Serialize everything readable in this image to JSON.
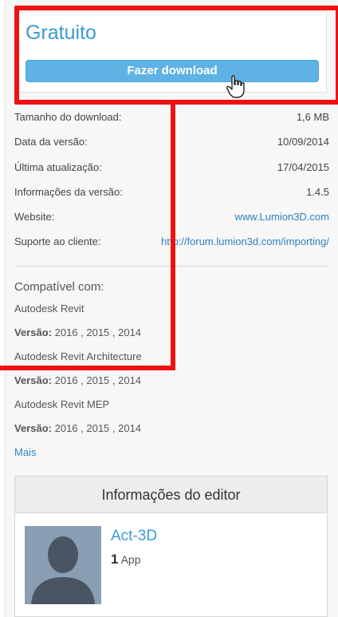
{
  "pricing": {
    "price": "Gratuito",
    "download_label": "Fazer download"
  },
  "details": [
    {
      "label": "Tamanho do download:",
      "value": "1,6 MB"
    },
    {
      "label": "Data da versão:",
      "value": "10/09/2014"
    },
    {
      "label": "Última atualização:",
      "value": "17/04/2015"
    },
    {
      "label": "Informações da versão:",
      "value": "1.4.5"
    },
    {
      "label": "Website:",
      "value": "www.Lumion3D.com"
    },
    {
      "label": "Suporte ao cliente:",
      "value": "http://forum.lumion3d.com/importing/"
    }
  ],
  "compatibility": {
    "title": "Compatível com:",
    "version_label": "Versão:",
    "products": [
      {
        "name": "Autodesk Revit",
        "versions": "2016 , 2015 , 2014"
      },
      {
        "name": "Autodesk Revit Architecture",
        "versions": "2016 , 2015 , 2014"
      },
      {
        "name": "Autodesk Revit MEP",
        "versions": "2016 , 2015 , 2014"
      }
    ],
    "more_label": "Mais"
  },
  "editor": {
    "heading": "Informações do editor",
    "name": "Act-3D",
    "app_count": "1",
    "app_label": "App"
  },
  "colors": {
    "accent_blue": "#3a9ad6",
    "button_blue": "#5fb2e4",
    "highlight_red": "#ee1111"
  },
  "icons": [
    "hand-pointer-cursor-icon",
    "user-silhouette-icon"
  ]
}
